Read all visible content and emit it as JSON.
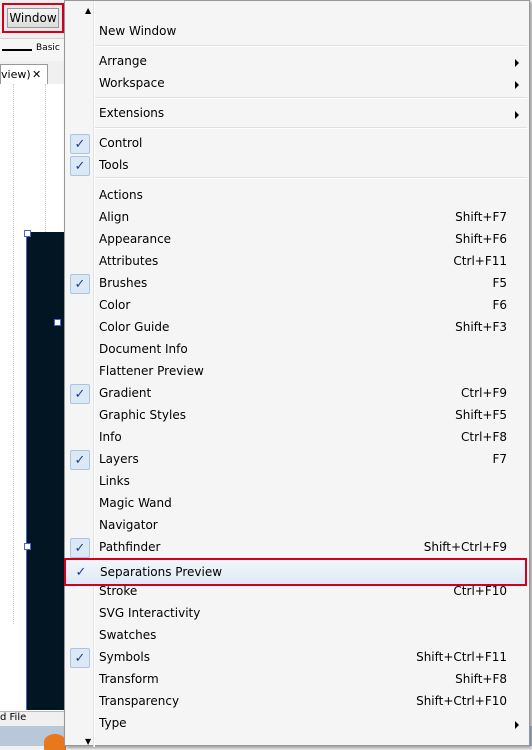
{
  "window_button": "Window",
  "control_bar": {
    "style_label": "Basic"
  },
  "doc_tab": {
    "label": "view)",
    "close": "✕"
  },
  "bottom_bar": {
    "label": "d File"
  },
  "menu": {
    "items": [
      {
        "label": "New Window",
        "shortcut": "",
        "checked": false,
        "submenu": false
      },
      {
        "label": "Arrange",
        "shortcut": "",
        "checked": false,
        "submenu": true
      },
      {
        "label": "Workspace",
        "shortcut": "",
        "checked": false,
        "submenu": true
      },
      {
        "label": "Extensions",
        "shortcut": "",
        "checked": false,
        "submenu": true
      },
      {
        "label": "Control",
        "shortcut": "",
        "checked": true,
        "submenu": false
      },
      {
        "label": "Tools",
        "shortcut": "",
        "checked": true,
        "submenu": false
      },
      {
        "label": "Actions",
        "shortcut": "",
        "checked": false,
        "submenu": false
      },
      {
        "label": "Align",
        "shortcut": "Shift+F7",
        "checked": false,
        "submenu": false
      },
      {
        "label": "Appearance",
        "shortcut": "Shift+F6",
        "checked": false,
        "submenu": false
      },
      {
        "label": "Attributes",
        "shortcut": "Ctrl+F11",
        "checked": false,
        "submenu": false
      },
      {
        "label": "Brushes",
        "shortcut": "F5",
        "checked": true,
        "submenu": false
      },
      {
        "label": "Color",
        "shortcut": "F6",
        "checked": false,
        "submenu": false
      },
      {
        "label": "Color Guide",
        "shortcut": "Shift+F3",
        "checked": false,
        "submenu": false
      },
      {
        "label": "Document Info",
        "shortcut": "",
        "checked": false,
        "submenu": false
      },
      {
        "label": "Flattener Preview",
        "shortcut": "",
        "checked": false,
        "submenu": false
      },
      {
        "label": "Gradient",
        "shortcut": "Ctrl+F9",
        "checked": true,
        "submenu": false
      },
      {
        "label": "Graphic Styles",
        "shortcut": "Shift+F5",
        "checked": false,
        "submenu": false
      },
      {
        "label": "Info",
        "shortcut": "Ctrl+F8",
        "checked": false,
        "submenu": false
      },
      {
        "label": "Layers",
        "shortcut": "F7",
        "checked": true,
        "submenu": false
      },
      {
        "label": "Links",
        "shortcut": "",
        "checked": false,
        "submenu": false
      },
      {
        "label": "Magic Wand",
        "shortcut": "",
        "checked": false,
        "submenu": false
      },
      {
        "label": "Navigator",
        "shortcut": "",
        "checked": false,
        "submenu": false
      },
      {
        "label": "Pathfinder",
        "shortcut": "Shift+Ctrl+F9",
        "checked": true,
        "submenu": false
      },
      {
        "label": "Separations Preview",
        "shortcut": "",
        "checked": true,
        "submenu": false,
        "highlighted": true
      },
      {
        "label": "Stroke",
        "shortcut": "Ctrl+F10",
        "checked": false,
        "submenu": false
      },
      {
        "label": "SVG Interactivity",
        "shortcut": "",
        "checked": false,
        "submenu": false
      },
      {
        "label": "Swatches",
        "shortcut": "",
        "checked": false,
        "submenu": false
      },
      {
        "label": "Symbols",
        "shortcut": "Shift+Ctrl+F11",
        "checked": true,
        "submenu": false
      },
      {
        "label": "Transform",
        "shortcut": "Shift+F8",
        "checked": false,
        "submenu": false
      },
      {
        "label": "Transparency",
        "shortcut": "Shift+Ctrl+F10",
        "checked": false,
        "submenu": false
      },
      {
        "label": "Type",
        "shortcut": "",
        "checked": false,
        "submenu": true
      }
    ],
    "check_glyph": "✓",
    "scroll_up_glyph": "▲",
    "scroll_down_glyph": "▼"
  },
  "colors": {
    "highlight_border": "#d1001c",
    "check": "#1c3da6",
    "artwork": "#021523"
  }
}
